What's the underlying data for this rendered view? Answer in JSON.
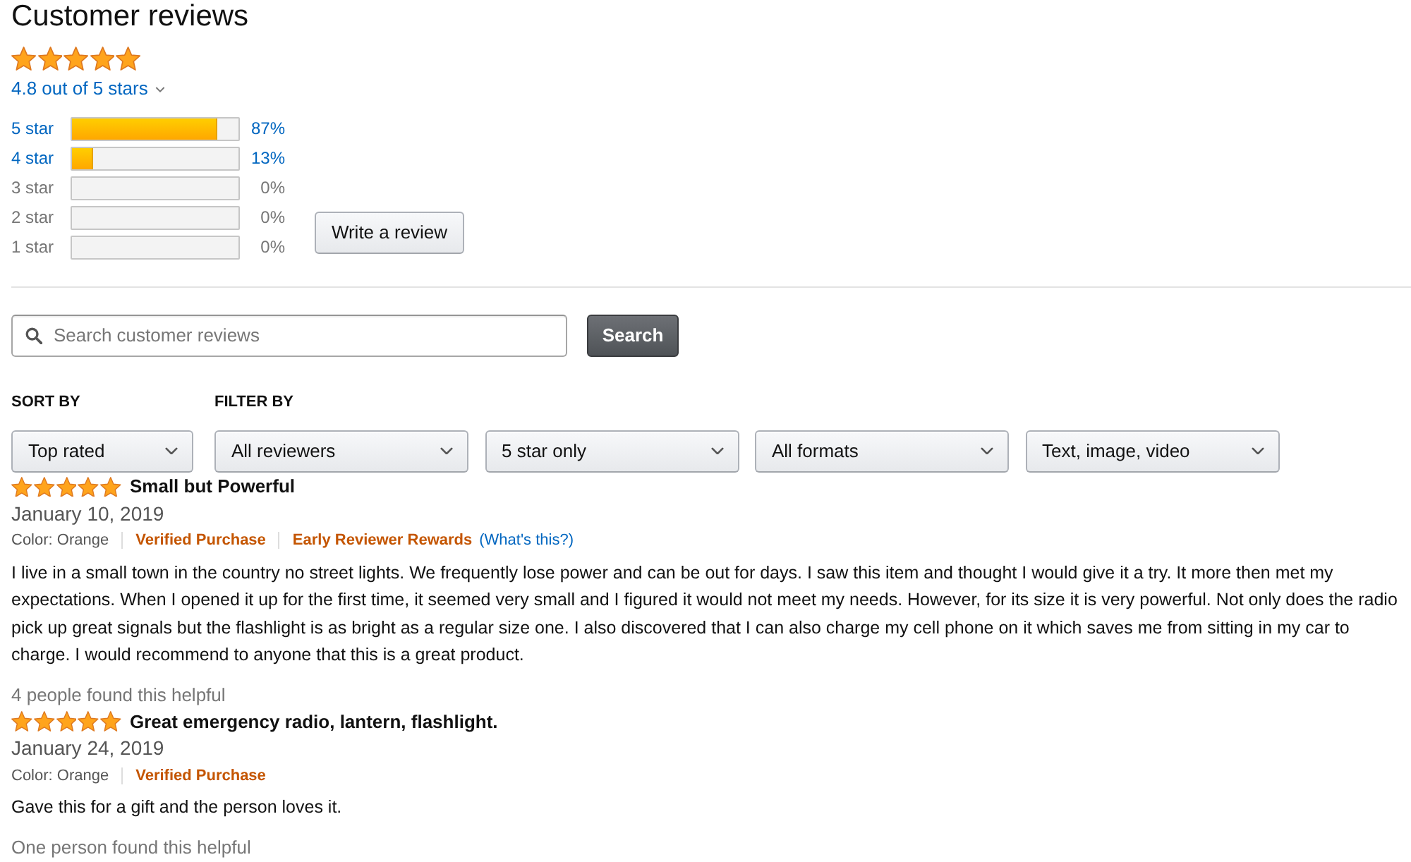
{
  "header": {
    "title": "Customer reviews",
    "stars": 5,
    "rating_text": "4.8 out of 5 stars"
  },
  "histogram": [
    {
      "label": "5 star",
      "level": 0.87,
      "percent": "87%",
      "disabled": false
    },
    {
      "label": "4 star",
      "level": 0.13,
      "percent": "13%",
      "disabled": false
    },
    {
      "label": "3 star",
      "level": 0,
      "percent": "0%",
      "disabled": true
    },
    {
      "label": "2 star",
      "level": 0,
      "percent": "0%",
      "disabled": true
    },
    {
      "label": "1 star",
      "level": 0,
      "percent": "0%",
      "disabled": true
    }
  ],
  "write_review_button": "Write a review",
  "search": {
    "placeholder": "Search customer reviews",
    "button": "Search"
  },
  "sort": {
    "label": "SORT BY",
    "dropdowns": [
      "Top rated"
    ]
  },
  "filter": {
    "label": "FILTER BY",
    "dropdowns": [
      "All reviewers",
      "5 star only",
      "All formats",
      "Text, image, video"
    ]
  },
  "reviews": [
    {
      "stars": 5,
      "title": "Small but Powerful",
      "date": "January 10, 2019",
      "meta": [
        {
          "kind": "plain",
          "text": "Color: Orange"
        },
        {
          "kind": "highlight",
          "text": "Verified Purchase"
        },
        {
          "kind": "highlight",
          "text": "Early Reviewer Rewards"
        },
        {
          "kind": "link",
          "text": "(What's this?)"
        }
      ],
      "body": "I live in a small town in the country no street lights. We frequently lose power and can be out for days. I saw this item and thought I would give it a try. It more then met my expectations. When I opened it up for the first time, it seemed very small and I figured it would not meet my needs. However, for its size it is very powerful. Not only does the radio pick up great signals but the flashlight is as bright as a regular size one. I also discovered that I can also charge my cell phone on it which saves me from sitting in my car to charge. I would recommend to anyone that this is a great product.",
      "helpful": "4 people found this helpful"
    },
    {
      "stars": 5,
      "title": "Great emergency radio, lantern, flashlight.",
      "date": "January 24, 2019",
      "meta": [
        {
          "kind": "plain",
          "text": "Color: Orange"
        },
        {
          "kind": "highlight",
          "text": "Verified Purchase"
        }
      ],
      "body": "Gave this for a gift and the person loves it.",
      "helpful": "One person found this helpful"
    }
  ]
}
